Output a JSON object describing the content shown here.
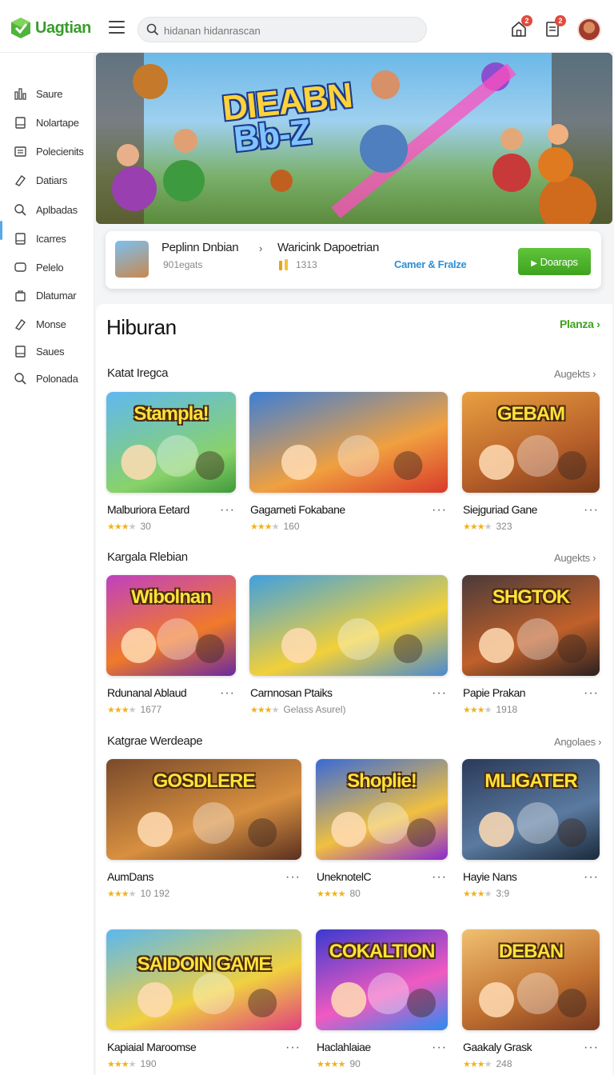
{
  "header": {
    "brand": "Uagtian",
    "search_placeholder": "hidanan hidanrascan",
    "notif_badge": "2",
    "cart_badge": "2"
  },
  "sidebar": {
    "items": [
      {
        "label": "Saure",
        "icon": "bar-chart-icon"
      },
      {
        "label": "Nolartape",
        "icon": "bookmark-icon"
      },
      {
        "label": "Polecienits",
        "icon": "grid-icon"
      },
      {
        "label": "Datiars",
        "icon": "tag-icon"
      },
      {
        "label": "Aplbadas",
        "icon": "search-icon"
      },
      {
        "label": "Icarres",
        "icon": "bookmark-icon"
      },
      {
        "label": "Pelelo",
        "icon": "chat-icon"
      },
      {
        "label": "Dlatumar",
        "icon": "bag-icon"
      },
      {
        "label": "Monse",
        "icon": "tag-icon"
      },
      {
        "label": "Saues",
        "icon": "bookmark-icon"
      },
      {
        "label": "Polonada",
        "icon": "search-icon"
      }
    ]
  },
  "hero": {
    "title_line1": "DIEABN",
    "title_line2": "Bb-Z"
  },
  "infocard": {
    "name1": "Peplinn Dnbian",
    "sub1": "901egats",
    "name2": "Waricink Dapoetrian",
    "sub2": "1313",
    "link": "Camer & Fralze",
    "button": "Doaraps"
  },
  "section": {
    "title": "Hiburan",
    "link": "Planza"
  },
  "categories": [
    {
      "title": "Katat Iregca",
      "more": "Augekts"
    },
    {
      "title": "Kargala Rlebian",
      "more": "Augekts"
    },
    {
      "title": "Katgrae Werdeape",
      "more": "Angolaes"
    }
  ],
  "games": [
    {
      "title": "Malburiora Eetard",
      "meta": "30",
      "thumb": "Stampla!",
      "stars": 3
    },
    {
      "title": "Gagarneti Fokabane",
      "meta": "160",
      "thumb": "",
      "stars": 3
    },
    {
      "title": "Siejguriad Gane",
      "meta": "323",
      "thumb": "GEBAM",
      "stars": 3
    },
    {
      "title": "Rdunanal Ablaud",
      "meta": "1677",
      "thumb": "Wibolnan",
      "stars": 3
    },
    {
      "title": "Carnnosan Ptaiks",
      "meta": "Gelass Asurel)",
      "thumb": "",
      "stars": 3
    },
    {
      "title": "Papie Prakan",
      "meta": "1918",
      "thumb": "SHGTOK",
      "stars": 3
    },
    {
      "title": "AumDans",
      "meta": "10  192",
      "thumb": "GOSDLERE",
      "stars": 3
    },
    {
      "title": "UneknotelC",
      "meta": "80",
      "thumb": "Shoplie!",
      "stars": 4
    },
    {
      "title": "Hayie Nans",
      "meta": "3:9",
      "thumb": "MLIGATER",
      "stars": 3
    },
    {
      "title": "Kapiaial Maroomse",
      "meta": "190",
      "thumb": "SAIDOIN GAME",
      "stars": 3
    },
    {
      "title": "Haclahlaiae",
      "meta": "90",
      "thumb": "COKALTION",
      "stars": 4
    },
    {
      "title": "Gaakaly Grask",
      "meta": "248",
      "thumb": "DEBAN",
      "stars": 3
    }
  ],
  "colors": {
    "accent_green": "#3fa21f",
    "link_blue": "#2e8fd4",
    "star": "#f0b31c"
  }
}
